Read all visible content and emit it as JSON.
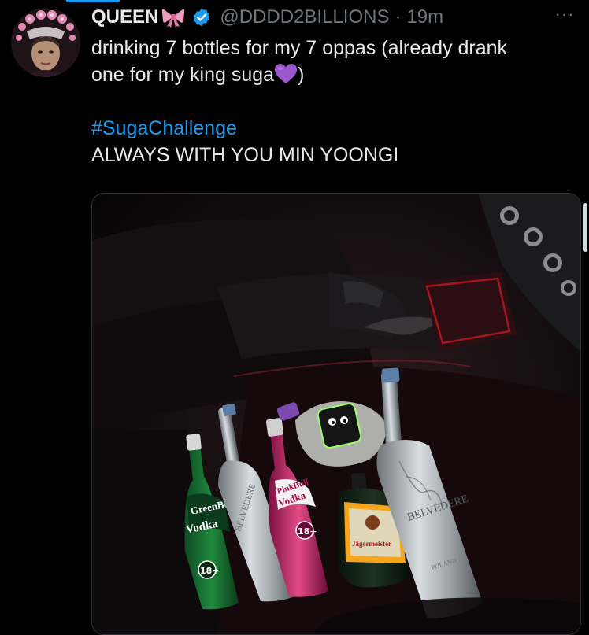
{
  "author": {
    "display_name": "QUEEN",
    "name_emoji": "ribbon-emoji",
    "verified": true,
    "handle": "@DDDD2BILLIONS",
    "separator": "·",
    "timestamp": "19m"
  },
  "more_menu": {
    "label": "···"
  },
  "tweet": {
    "line1": "drinking 7 bottles for my 7 oppas (already drank",
    "line2_prefix": "one for my king suga",
    "line2_suffix": ")",
    "hashtag": "#SugaChallenge",
    "line4": "ALWAYS WITH YOU MIN YOONGI"
  },
  "media": {
    "bottle_labels": {
      "greenbull_brand": "GreenBull",
      "greenbull_type": "Vodka",
      "greenbull_age": "18+",
      "pinkbull_brand": "PinkBull",
      "pinkbull_type": "Vodka",
      "pinkbull_age": "18+",
      "jager": "Jägermeister",
      "belvedere_1": "BELVEDERE",
      "belvedere_2": "BELVEDERE",
      "poland": "POLAND"
    }
  },
  "colors": {
    "background": "#000000",
    "text": "#e7e9ea",
    "muted": "#71767b",
    "accent": "#1d9bf0",
    "heart": "#9b59d0",
    "ribbon": "#f29abf"
  }
}
